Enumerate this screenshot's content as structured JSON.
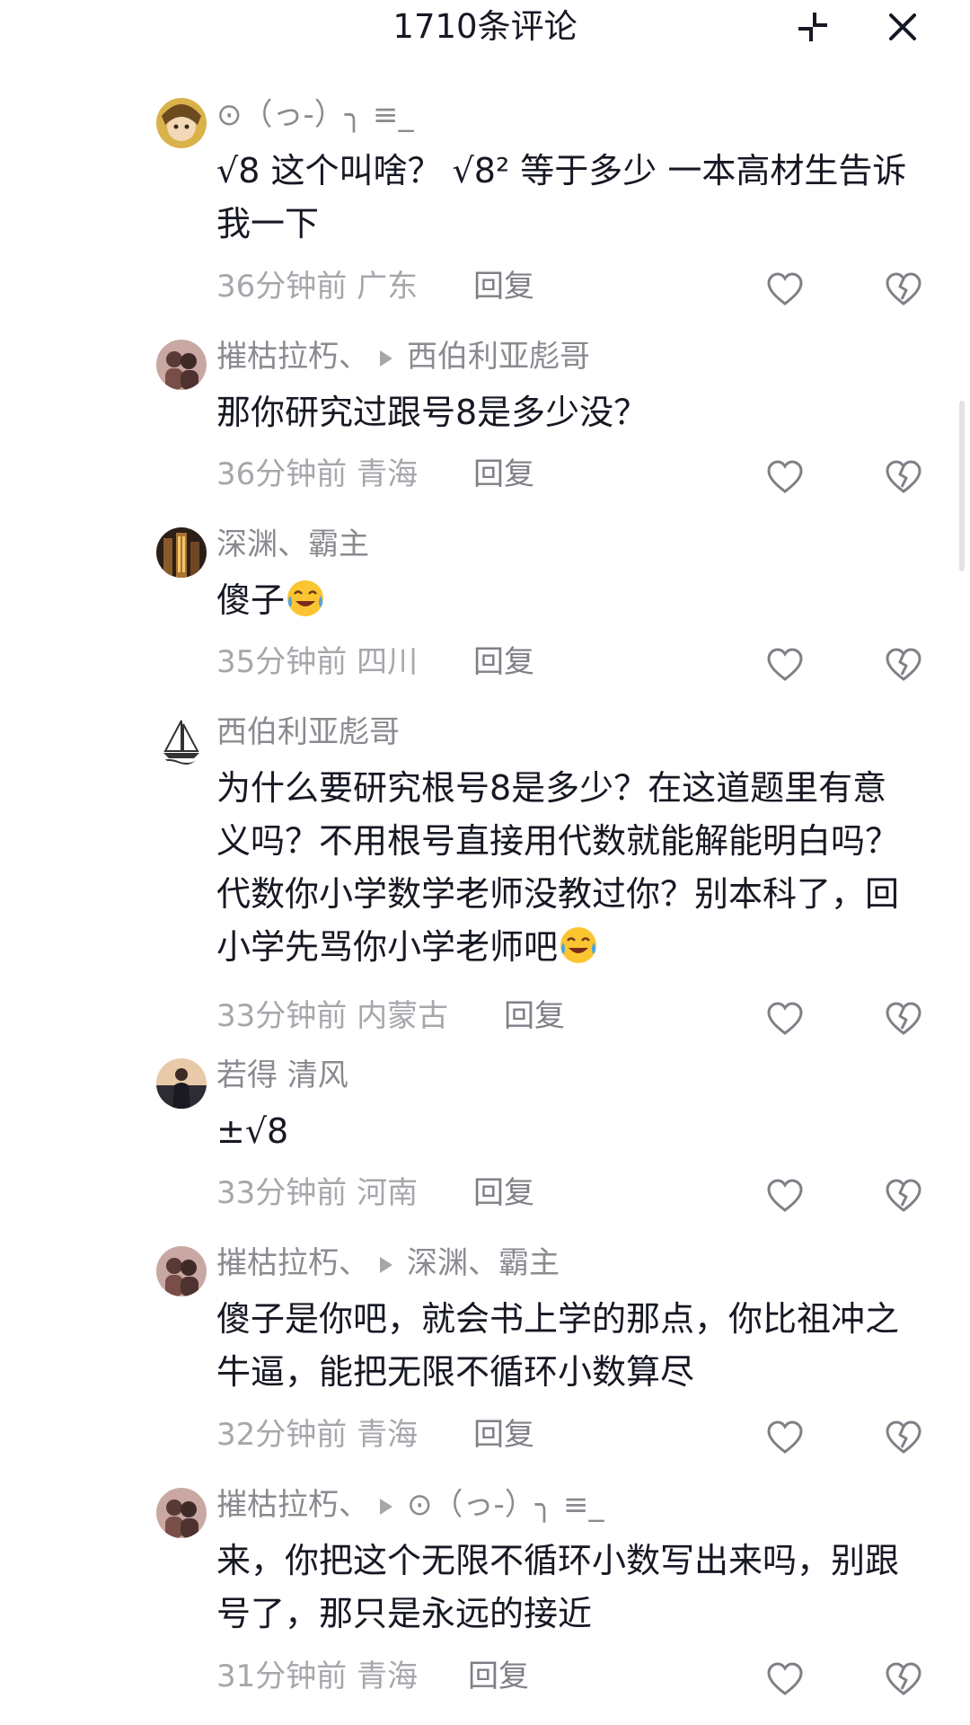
{
  "header": {
    "title": "1710条评论"
  },
  "comments": [
    {
      "user": "⊙（っ-）╮ ≡_",
      "reply_to": "",
      "text": "√8 这个叫啥？ √8² 等于多少 一本高材生告诉我一下",
      "time": "36分钟前",
      "location": "广东",
      "reply_label": "回复",
      "avatar": "anime-avatar"
    },
    {
      "user": "摧枯拉朽、",
      "reply_to": "西伯利亚彪哥",
      "text": "那你研究过跟号8是多少没？",
      "time": "36分钟前",
      "location": "青海",
      "reply_label": "回复",
      "avatar": "couple-avatar"
    },
    {
      "user": "深渊、霸主",
      "reply_to": "",
      "text": "傻子",
      "emoji": "laugh-cry-emoji",
      "time": "35分钟前",
      "location": "四川",
      "reply_label": "回复",
      "avatar": "building-avatar"
    },
    {
      "user": "西伯利亚彪哥",
      "reply_to": "",
      "text": "为什么要研究根号8是多少？在这道题里有意义吗？不用根号直接用代数就能解能明白吗？代数你小学数学老师没教过你？别本科了，回小学先骂你小学老师吧",
      "emoji": "laugh-cry-emoji",
      "time": "33分钟前",
      "location": "内蒙古",
      "reply_label": "回复",
      "avatar": "sailboat-avatar"
    },
    {
      "user": "若得 清风",
      "reply_to": "",
      "text": "±√8",
      "time": "33分钟前",
      "location": "河南",
      "reply_label": "回复",
      "avatar": "sunset-avatar"
    },
    {
      "user": "摧枯拉朽、",
      "reply_to": "深渊、霸主",
      "text": "傻子是你吧，就会书上学的那点，你比祖冲之牛逼，能把无限不循环小数算尽",
      "time": "32分钟前",
      "location": "青海",
      "reply_label": "回复",
      "avatar": "couple-avatar"
    },
    {
      "user": "摧枯拉朽、",
      "reply_to": "⊙（っ-）╮ ≡_",
      "text": "来，你把这个无限不循环小数写出来吗，别跟号了，那只是永远的接近",
      "time": "31分钟前",
      "location": "青海",
      "reply_label": "回复",
      "avatar": "couple-avatar"
    }
  ]
}
